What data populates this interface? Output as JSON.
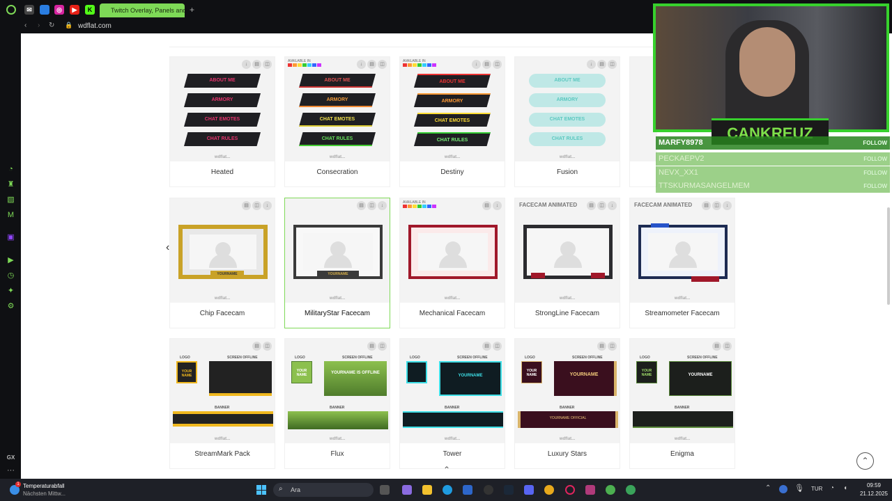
{
  "browser": {
    "active_tab_title": "Twitch Overlay, Panels and",
    "url": "wdflat.com",
    "new_tab_symbol": "+"
  },
  "products": [
    {
      "name": "Heated",
      "kind": "panels",
      "colors": [
        "#e8336d"
      ],
      "panels": [
        "ABOUT ME",
        "ARMORY",
        "CHAT EMOTES",
        "CHAT RULES"
      ]
    },
    {
      "name": "Consecration",
      "kind": "panels",
      "available_in": "AVAILABLE IN",
      "panels": [
        "ABOUT ME",
        "ARMORY",
        "CHAT EMOTES",
        "CHAT RULES"
      ]
    },
    {
      "name": "Destiny",
      "kind": "panels",
      "available_in": "AVAILABLE IN",
      "panels": [
        "ABOUT ME",
        "ARMORY",
        "CHAT EMOTES",
        "CHAT RULES"
      ]
    },
    {
      "name": "Fusion",
      "kind": "panels",
      "panels": [
        "ABOUT ME",
        "ARMORY",
        "CHAT EMOTES",
        "CHAT RULES"
      ]
    },
    {
      "name": "Chip Facecam",
      "kind": "facecam"
    },
    {
      "name": "MilitaryStar Facecam",
      "kind": "facecam"
    },
    {
      "name": "Mechanical Facecam",
      "kind": "facecam",
      "available_in": "AVAILABLE IN"
    },
    {
      "name": "StrongLine Facecam",
      "kind": "facecam",
      "tag": "FACECAM ANIMATED"
    },
    {
      "name": "Streamometer Facecam",
      "kind": "facecam",
      "tag": "FACECAM ANIMATED"
    },
    {
      "name": "StreamMark Pack",
      "kind": "pack"
    },
    {
      "name": "Flux",
      "kind": "pack"
    },
    {
      "name": "Tower",
      "kind": "pack"
    },
    {
      "name": "Luxury Stars",
      "kind": "pack"
    },
    {
      "name": "Enigma",
      "kind": "pack"
    }
  ],
  "thumb_texts": {
    "watermark": "wdflat...",
    "yourname": "YOURNAME",
    "pack_logo": "LOGO",
    "pack_offline": "SCREEN OFFLINE",
    "pack_banner": "BANNER",
    "pack_your_name": "YOUR NAME",
    "pack_offline_text": "YOURNAME IS OFFLINE",
    "pack_official": "YOURNAME OFFICIAL"
  },
  "stream_overlay": {
    "streamer_name": "CANKREUZ",
    "follows": [
      {
        "user": "MARFY8978",
        "label": "FOLLOW"
      },
      {
        "user": "PECKAEPV2",
        "label": "FOLLOW"
      },
      {
        "user": "NEVX_XX1",
        "label": "FOLLOW"
      },
      {
        "user": "TTSKURMASANGELMEM",
        "label": "FOLLOW"
      }
    ]
  },
  "taskbar": {
    "weather_title": "Temperaturabfall",
    "weather_sub": "Nächsten Mittw...",
    "search_placeholder": "Ara",
    "lang": "TUR",
    "time": "09:59",
    "date": "21.12.2025",
    "notification_count": "1"
  },
  "sidebar_label": "GX",
  "colors": {
    "accent": "#7ed957",
    "overlay_green": "#37d12d",
    "panel_red": "#e8336d"
  }
}
